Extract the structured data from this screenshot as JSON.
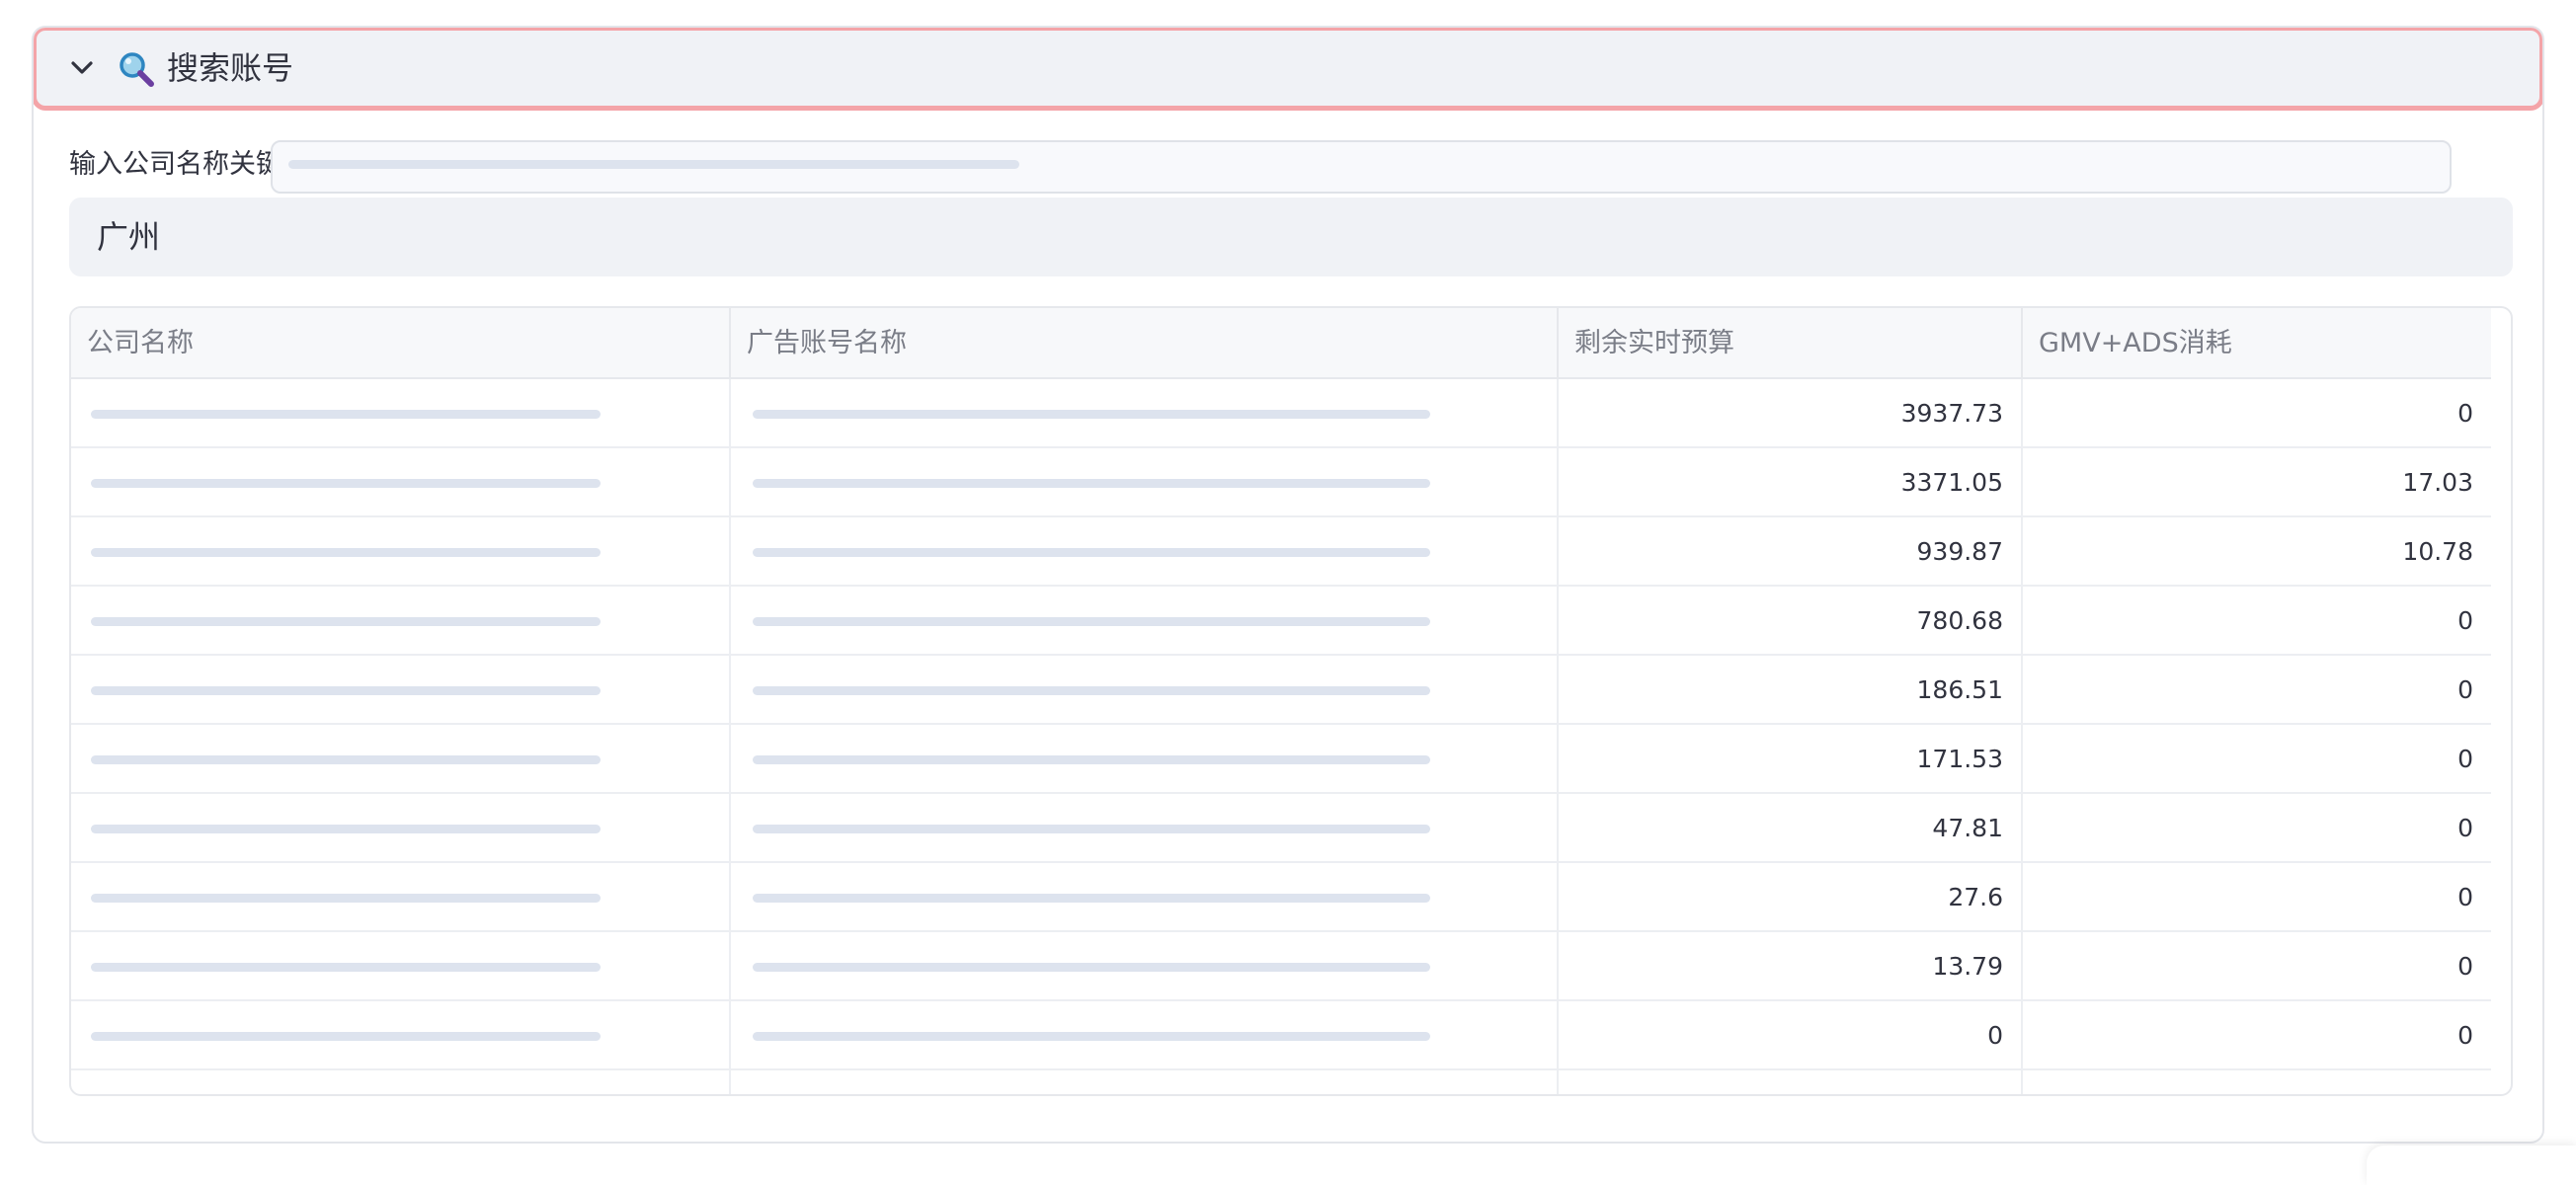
{
  "expander": {
    "title": "搜索账号",
    "toggle_icon": "chevron-down-icon",
    "title_icon": "magnifying-glass-emoji"
  },
  "search": {
    "label": "输入公司名称关键",
    "value": "",
    "skeleton": true
  },
  "region": {
    "value": "广州"
  },
  "table": {
    "columns": [
      "公司名称",
      "广告账号名称",
      "剩余实时预算",
      "GMV+ADS消耗"
    ],
    "rows": [
      {
        "remaining_budget": "3937.73",
        "gmv_ads_spend": "0"
      },
      {
        "remaining_budget": "3371.05",
        "gmv_ads_spend": "17.03"
      },
      {
        "remaining_budget": "939.87",
        "gmv_ads_spend": "10.78"
      },
      {
        "remaining_budget": "780.68",
        "gmv_ads_spend": "0"
      },
      {
        "remaining_budget": "186.51",
        "gmv_ads_spend": "0"
      },
      {
        "remaining_budget": "171.53",
        "gmv_ads_spend": "0"
      },
      {
        "remaining_budget": "47.81",
        "gmv_ads_spend": "0"
      },
      {
        "remaining_budget": "27.6",
        "gmv_ads_spend": "0"
      },
      {
        "remaining_budget": "13.79",
        "gmv_ads_spend": "0"
      },
      {
        "remaining_budget": "0",
        "gmv_ads_spend": "0"
      }
    ]
  },
  "colors": {
    "header_highlight_border": "#f4a4a8",
    "panel_bg": "#f0f2f6",
    "skeleton": "#dde3ee",
    "text": "#31333f",
    "muted_text": "#7a7d87"
  }
}
